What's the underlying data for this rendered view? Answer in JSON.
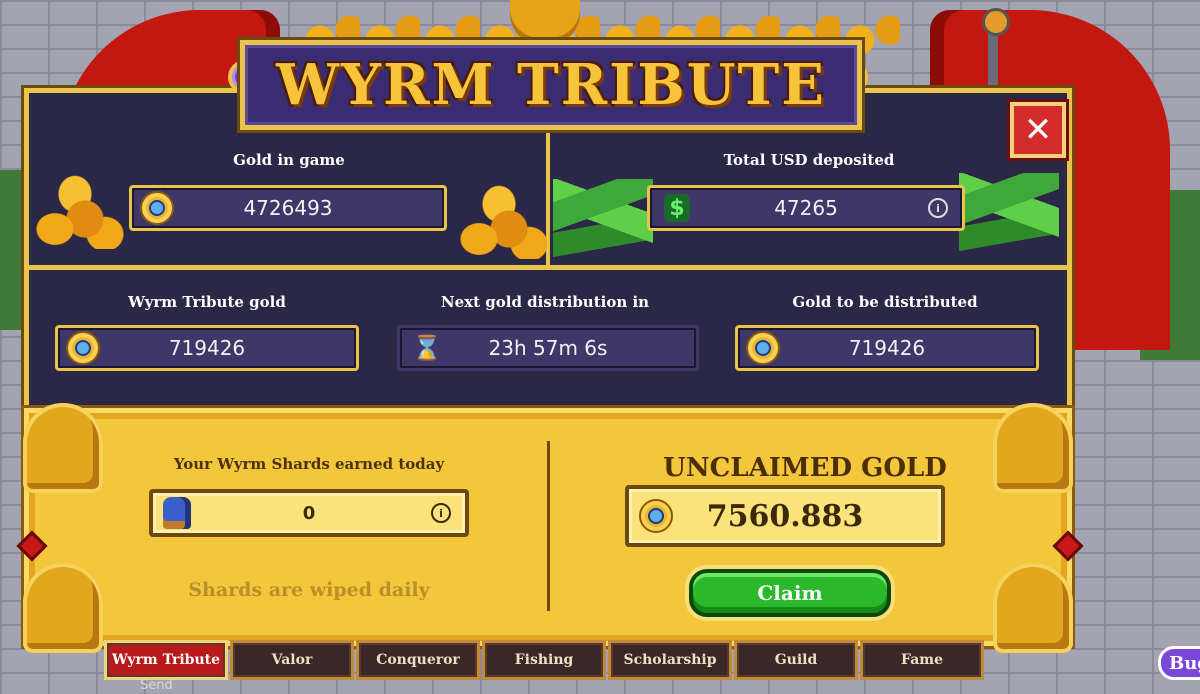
{
  "title": "WYRM TRIBUTE",
  "stats_top": {
    "gold_in_game": {
      "label": "Gold in game",
      "value": "4726493",
      "icon": "coin-icon"
    },
    "total_usd": {
      "label": "Total USD deposited",
      "value": "47265",
      "icon": "dollar-icon"
    }
  },
  "stats_mid": {
    "wyrm_tribute_gold": {
      "label": "Wyrm Tribute gold",
      "value": "719426",
      "icon": "coin-icon"
    },
    "next_distribution": {
      "label": "Next gold distribution in",
      "value": "23h 57m 6s",
      "icon": "hourglass-icon"
    },
    "gold_to_distribute": {
      "label": "Gold to be distributed",
      "value": "719426",
      "icon": "coin-icon"
    }
  },
  "shards": {
    "label": "Your Wyrm Shards earned today",
    "value": "0",
    "note": "Shards are wiped daily"
  },
  "unclaimed": {
    "title": "UNCLAIMED GOLD",
    "value": "7560.883",
    "claim_label": "Claim"
  },
  "close_label": "✕",
  "info_glyph": "i",
  "tabs": [
    {
      "label": "Wyrm Tribute",
      "active": true
    },
    {
      "label": "Valor",
      "active": false
    },
    {
      "label": "Conqueror",
      "active": false
    },
    {
      "label": "Fishing",
      "active": false
    },
    {
      "label": "Scholarship",
      "active": false
    },
    {
      "label": "Guild",
      "active": false
    },
    {
      "label": "Fame",
      "active": false
    }
  ],
  "bug_button": "Bug",
  "chat_send": "Send",
  "colors": {
    "panel_bg": "#2b2746",
    "gold_border": "#e9c34a",
    "gold_panel": "#f3c63c",
    "claim_green": "#2bb82b",
    "active_tab": "#b81a1a"
  }
}
